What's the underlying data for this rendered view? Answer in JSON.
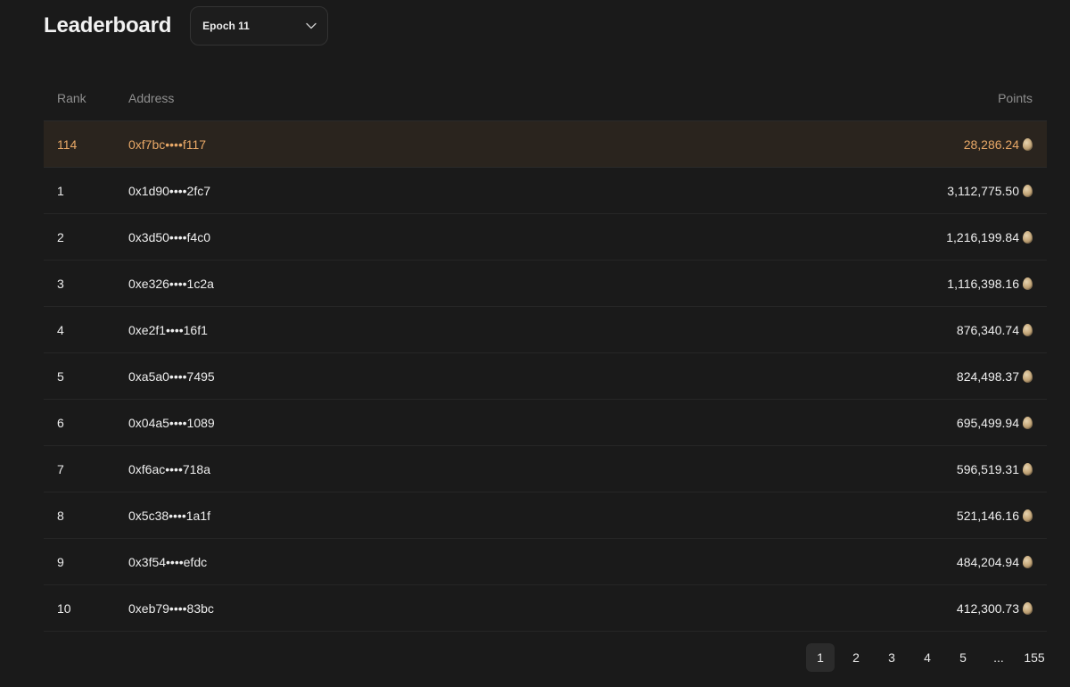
{
  "header": {
    "title": "Leaderboard",
    "epoch_selected": "Epoch 11"
  },
  "table": {
    "columns": {
      "rank": "Rank",
      "address": "Address",
      "points": "Points"
    },
    "current_user": {
      "rank": "114",
      "address": "0xf7bc••••f117",
      "points": "28,286.24"
    },
    "rows": [
      {
        "rank": "1",
        "address": "0x1d90••••2fc7",
        "points": "3,112,775.50"
      },
      {
        "rank": "2",
        "address": "0x3d50••••f4c0",
        "points": "1,216,199.84"
      },
      {
        "rank": "3",
        "address": "0xe326••••1c2a",
        "points": "1,116,398.16"
      },
      {
        "rank": "4",
        "address": "0xe2f1••••16f1",
        "points": "876,340.74"
      },
      {
        "rank": "5",
        "address": "0xa5a0••••7495",
        "points": "824,498.37"
      },
      {
        "rank": "6",
        "address": "0x04a5••••1089",
        "points": "695,499.94"
      },
      {
        "rank": "7",
        "address": "0xf6ac••••718a",
        "points": "596,519.31"
      },
      {
        "rank": "8",
        "address": "0x5c38••••1a1f",
        "points": "521,146.16"
      },
      {
        "rank": "9",
        "address": "0x3f54••••efdc",
        "points": "484,204.94"
      },
      {
        "rank": "10",
        "address": "0xeb79••••83bc",
        "points": "412,300.73"
      }
    ],
    "points_icon": "egg-icon"
  },
  "pagination": {
    "pages": [
      "1",
      "2",
      "3",
      "4",
      "5",
      "...",
      "155"
    ],
    "current": "1"
  },
  "colors": {
    "background": "#1a1a1a",
    "highlight_row": "#2a241e",
    "highlight_text": "#e8a867",
    "muted_text": "#8f8f8f"
  }
}
